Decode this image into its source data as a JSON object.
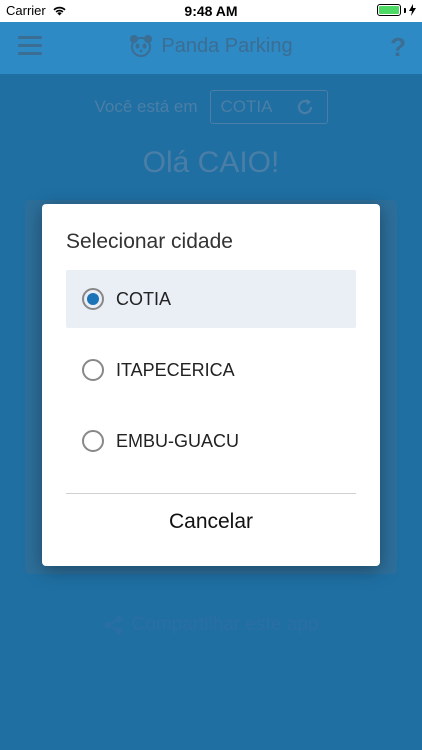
{
  "statusbar": {
    "carrier": "Carrier",
    "time": "9:48 AM"
  },
  "navbar": {
    "title": "Panda Parking",
    "help": "?"
  },
  "content": {
    "location_label": "Você está em",
    "current_city": "COTIA",
    "greeting": "Olá CAIO!",
    "share_label": "Compartilhar este app"
  },
  "dialog": {
    "title": "Selecionar cidade",
    "options": [
      {
        "label": "COTIA",
        "selected": true
      },
      {
        "label": "ITAPECERICA",
        "selected": false
      },
      {
        "label": "EMBU-GUACU",
        "selected": false
      }
    ],
    "cancel_label": "Cancelar"
  },
  "colors": {
    "accent": "#1b73b8",
    "background": "#2d8ac4"
  }
}
